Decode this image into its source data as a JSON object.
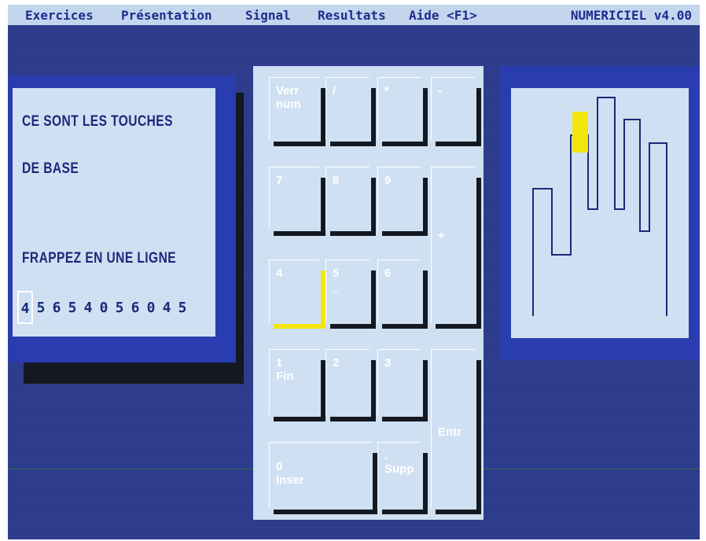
{
  "menu": {
    "items": [
      {
        "label": "Exercices"
      },
      {
        "label": "Présentation"
      },
      {
        "label": "Signal"
      },
      {
        "label": "Resultats"
      },
      {
        "label": "Aide <F1>"
      }
    ],
    "app_version": "NUMERICIEL v4.00"
  },
  "instructions": {
    "line1": "CE SONT LES TOUCHES",
    "line2": "DE BASE",
    "line3": "FRAPPEZ EN UNE LIGNE",
    "sequence": [
      "4",
      "5",
      "6",
      "5",
      "4",
      "0",
      "5",
      "6",
      "0",
      "4",
      "5"
    ],
    "current_index": 0
  },
  "keypad": {
    "keys": [
      {
        "id": "verr-num",
        "label": "Verr\nnum"
      },
      {
        "id": "divide",
        "label": "/"
      },
      {
        "id": "multiply",
        "label": "*"
      },
      {
        "id": "minus",
        "label": "-"
      },
      {
        "id": "7",
        "label": "7"
      },
      {
        "id": "8",
        "label": "8"
      },
      {
        "id": "9",
        "label": "9"
      },
      {
        "id": "plus",
        "label": "+"
      },
      {
        "id": "4",
        "label": "4"
      },
      {
        "id": "5",
        "label": "5\n_"
      },
      {
        "id": "6",
        "label": "6"
      },
      {
        "id": "1",
        "label": "1\nFin"
      },
      {
        "id": "2",
        "label": "2"
      },
      {
        "id": "3",
        "label": "3"
      },
      {
        "id": "entr",
        "label": "Entr"
      },
      {
        "id": "0",
        "label": "0\nInser"
      },
      {
        "id": "supp",
        "label": ".\nSupp"
      }
    ],
    "active_key": "4"
  },
  "hand": {
    "highlighted_finger": "index"
  },
  "colors": {
    "background": "#2c3a8c",
    "menubar": "#c4d6ee",
    "panel": "#cfe0f2",
    "text": "#1c2878",
    "highlight": "#f2e60c",
    "shadow": "#141820"
  }
}
